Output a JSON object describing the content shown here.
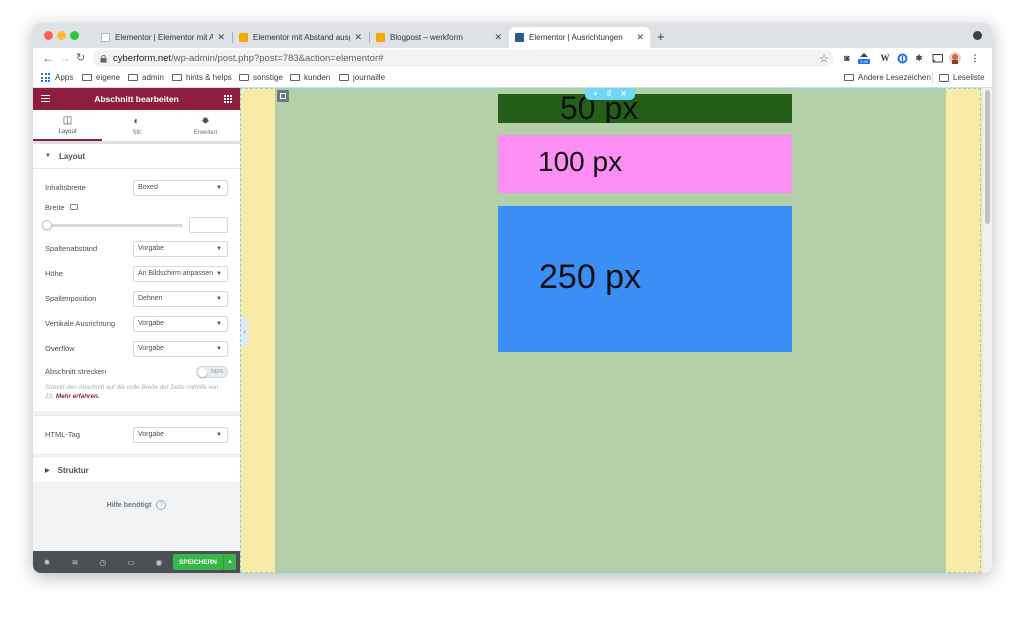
{
  "browser": {
    "tabs": [
      {
        "title": "Elementor | Elementor mit Abst",
        "favicon_color": "#ffffff"
      },
      {
        "title": "Elementor mit Abstand ausgeri",
        "favicon_color": "#f2a900"
      },
      {
        "title": "Blogpost – werkform",
        "favicon_color": "#f2a900"
      },
      {
        "title": "Elementor | Ausrichtungen",
        "favicon_color": "#2a5d8c",
        "active": true
      }
    ],
    "url_host": "cyberform.net",
    "url_path": "/wp-admin/post.php?post=783&action=elementor#",
    "extension_badge": "2.39"
  },
  "bookmarks": {
    "items": [
      {
        "label": "Apps",
        "icon": "apps-grid-icon"
      },
      {
        "label": "eigene",
        "icon": "folder-icon"
      },
      {
        "label": "admin",
        "icon": "folder-icon"
      },
      {
        "label": "hints & helps",
        "icon": "folder-icon"
      },
      {
        "label": "sonstige",
        "icon": "folder-icon"
      },
      {
        "label": "kunden",
        "icon": "folder-icon"
      },
      {
        "label": "journaille",
        "icon": "folder-icon"
      }
    ],
    "other": "Andere Lesezeichen",
    "reading_list": "Leseliste"
  },
  "panel": {
    "title": "Abschnitt bearbeiten",
    "tabs": [
      {
        "label": "Layout",
        "icon": "layout-icon",
        "active": true
      },
      {
        "label": "Stil",
        "icon": "style-icon"
      },
      {
        "label": "Erweitert",
        "icon": "gear-icon"
      }
    ],
    "section_layout": "Layout",
    "controls": {
      "inhaltsbreite": {
        "label": "Inhaltsbreite",
        "value": "Boxed"
      },
      "breite": {
        "label": "Breite",
        "slider_value": 0
      },
      "spaltenabstand": {
        "label": "Spaltenabstand",
        "value": "Vorgabe"
      },
      "hoehe": {
        "label": "Höhe",
        "value": "An Bildschirm anpassen"
      },
      "spaltenposition": {
        "label": "Spaltenposition",
        "value": "Dehnen"
      },
      "vertikale": {
        "label": "Vertikale Ausrichtung",
        "value": "Vorgabe"
      },
      "overflow": {
        "label": "Overflow",
        "value": "Vorgabe"
      },
      "strecken": {
        "label": "Abschnitt strecken",
        "toggle": "NEIN",
        "description": "Streckt den Abschnitt auf die volle Breite der Seite mithilfe von JS.",
        "more": "Mehr erfahren."
      },
      "html_tag": {
        "label": "HTML-Tag",
        "value": "Vorgabe"
      }
    },
    "section_struktur": "Struktur",
    "help": "Hilfe benötigt",
    "save": "SPEICHERN"
  },
  "canvas": {
    "colors": {
      "page_bg": "#f9eaa5",
      "section_bg": "#b3d0a9",
      "box1": "#245e18",
      "box2": "#fd8ef3",
      "box3": "#3a8ef6",
      "outline": "#71d7f7"
    },
    "boxes": [
      {
        "label": "50 px"
      },
      {
        "label": "100 px"
      },
      {
        "label": "250 px"
      }
    ]
  }
}
